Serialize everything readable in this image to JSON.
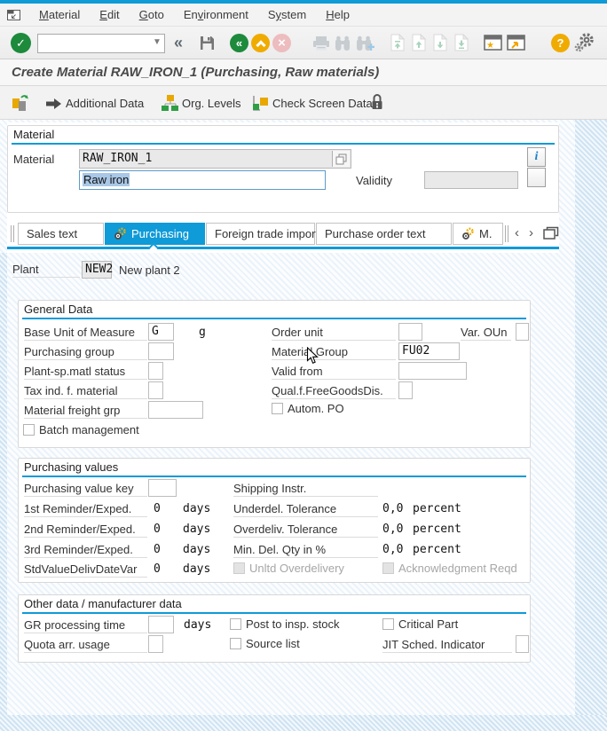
{
  "colors": {
    "accent": "#0f9ad8",
    "selection": "#a9c7e6",
    "green": "#1d8a3c",
    "orange": "#f0ab00",
    "pink": "#edbcbe"
  },
  "menu": {
    "items": [
      {
        "pre": "",
        "key": "M",
        "post": "aterial"
      },
      {
        "pre": "",
        "key": "E",
        "post": "dit"
      },
      {
        "pre": "",
        "key": "G",
        "post": "oto"
      },
      {
        "pre": "En",
        "key": "v",
        "post": "ironment"
      },
      {
        "pre": "S",
        "key": "y",
        "post": "stem"
      },
      {
        "pre": "",
        "key": "H",
        "post": "elp"
      }
    ]
  },
  "toolbar": {
    "command_value": ""
  },
  "title": "Create Material RAW_IRON_1 (Purchasing, Raw materials)",
  "app_toolbar": {
    "additional_data": "Additional Data",
    "org_levels": "Org. Levels",
    "check_screen_data": "Check Screen Data"
  },
  "material": {
    "box_title": "Material",
    "label": "Material",
    "number": "RAW_IRON_1",
    "description": "Raw iron",
    "validity_label": "Validity",
    "info_glyph": "i"
  },
  "tabs": {
    "items": [
      "Sales text",
      "Purchasing",
      "Foreign trade import",
      "Purchase order text",
      "M."
    ],
    "active": "Purchasing"
  },
  "plant": {
    "label": "Plant",
    "value": "NEW2",
    "name": "New plant 2"
  },
  "general": {
    "title": "General Data",
    "base_unit_label": "Base Unit of Measure",
    "base_unit_value": "G",
    "base_unit_text": "g",
    "order_unit_label": "Order unit",
    "order_unit_value": "",
    "var_oun_label": "Var. OUn",
    "var_oun_value": "",
    "purchasing_group_label": "Purchasing group",
    "purchasing_group_value": "",
    "material_group_label": "Material Group",
    "material_group_value": "FU02",
    "plant_status_label": "Plant-sp.matl status",
    "plant_status_value": "",
    "valid_from_label": "Valid from",
    "valid_from_value": "",
    "tax_ind_label": "Tax ind. f. material",
    "tax_ind_value": "",
    "qual_label": "Qual.f.FreeGoodsDis.",
    "qual_value": "",
    "freight_label": "Material freight grp",
    "freight_value": "",
    "autom_po_label": "Autom. PO",
    "batch_label": "Batch management"
  },
  "values": {
    "title": "Purchasing values",
    "pvk_label": "Purchasing value key",
    "pvk_value": "",
    "shipping_label": "Shipping Instr.",
    "rows": [
      {
        "label": "1st Reminder/Exped.",
        "value": "0",
        "unit": "days",
        "right_label": "Underdel. Tolerance",
        "right_value": "0,0",
        "right_unit": "percent"
      },
      {
        "label": "2nd Reminder/Exped.",
        "value": "0",
        "unit": "days",
        "right_label": "Overdeliv. Tolerance",
        "right_value": "0,0",
        "right_unit": "percent"
      },
      {
        "label": "3rd Reminder/Exped.",
        "value": "0",
        "unit": "days",
        "right_label": "Min. Del. Qty in %",
        "right_value": "0,0",
        "right_unit": "percent"
      }
    ],
    "std_label": "StdValueDelivDateVar",
    "std_value": "0",
    "std_unit": "days",
    "unltd_label": "Unltd Overdelivery",
    "ack_label": "Acknowledgment Reqd"
  },
  "other": {
    "title": "Other data / manufacturer data",
    "gr_label": "GR processing time",
    "gr_value": "",
    "gr_unit": "days",
    "post_insp_label": "Post to insp. stock",
    "critical_label": "Critical Part",
    "quota_label": "Quota arr. usage",
    "quota_value": "",
    "source_label": "Source list",
    "jit_label": "JIT Sched. Indicator",
    "jit_value": ""
  }
}
